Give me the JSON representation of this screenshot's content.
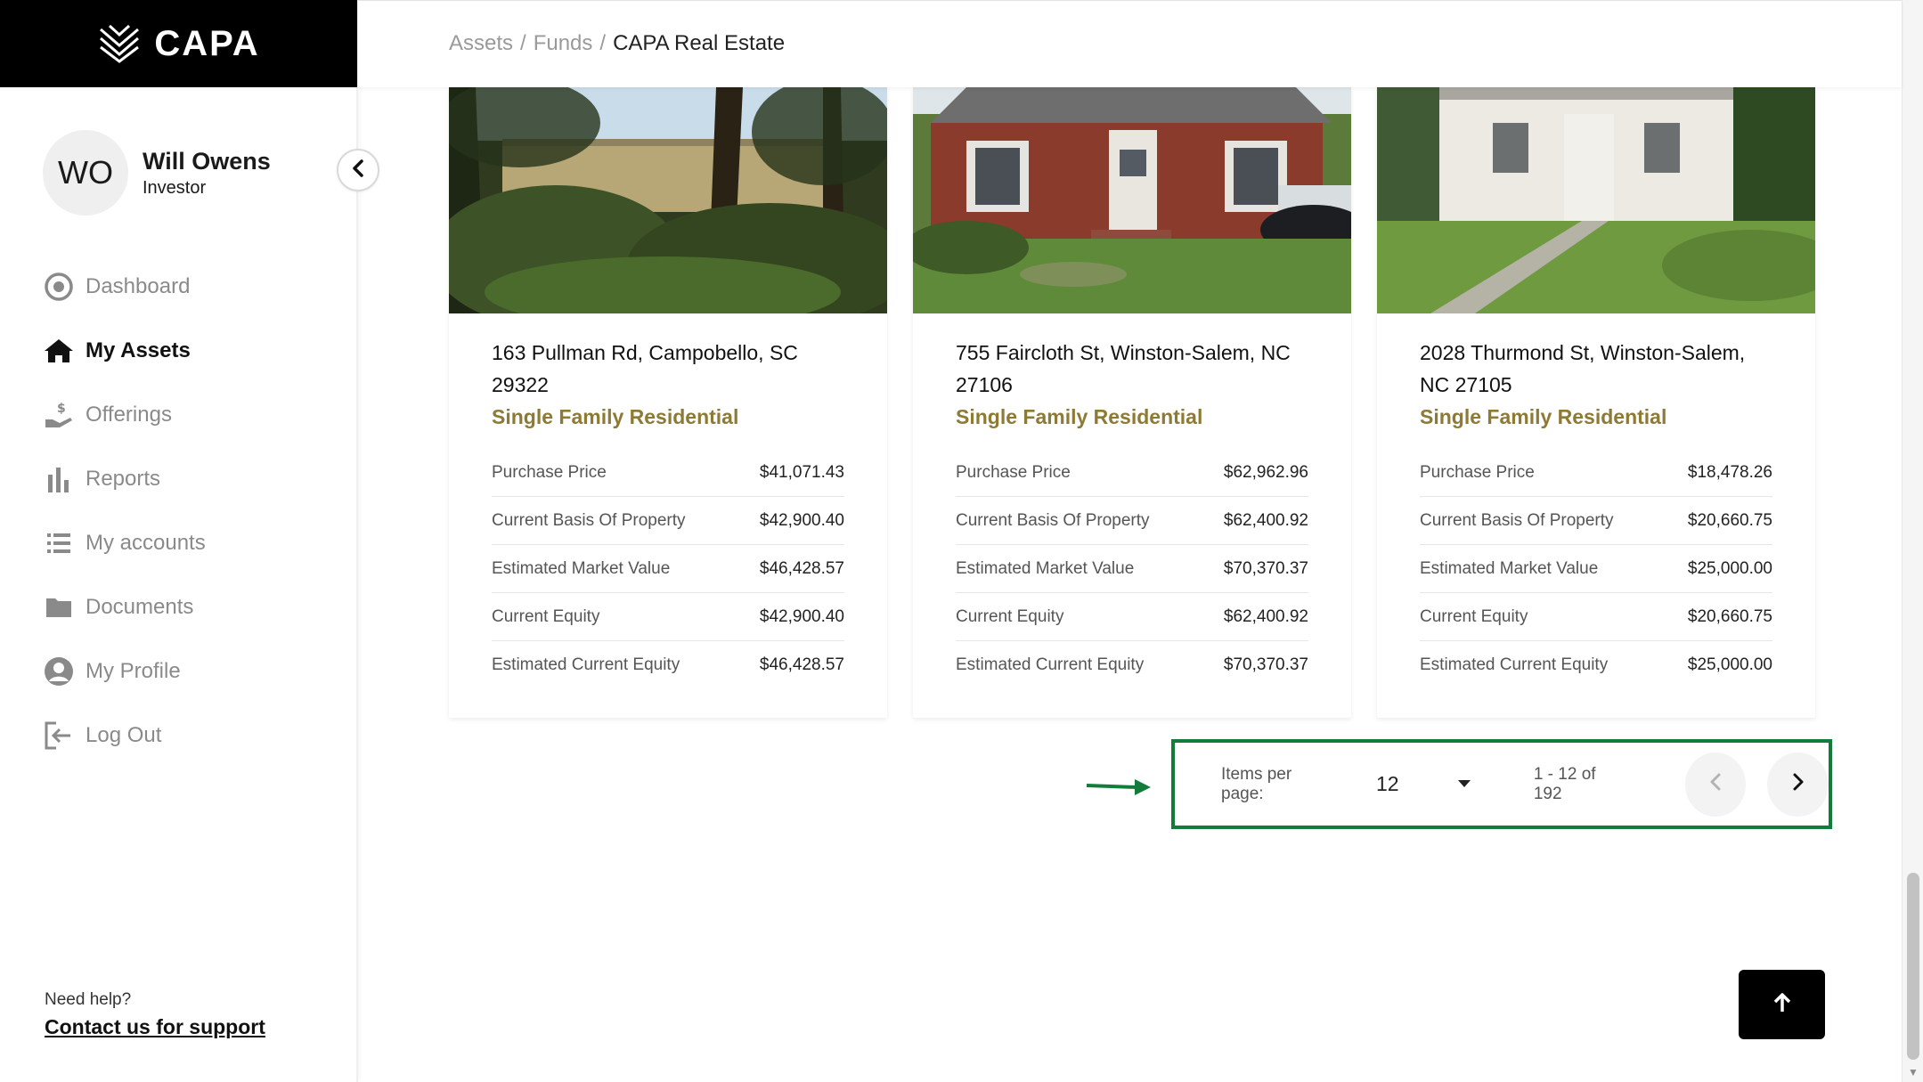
{
  "brand": {
    "name": "CAPA"
  },
  "user": {
    "initials": "WO",
    "name": "Will Owens",
    "role": "Investor"
  },
  "nav": [
    {
      "label": "Dashboard",
      "icon": "dashboard-icon"
    },
    {
      "label": "My Assets",
      "icon": "home-icon",
      "active": true
    },
    {
      "label": "Offerings",
      "icon": "hand-dollar-icon"
    },
    {
      "label": "Reports",
      "icon": "bar-chart-icon"
    },
    {
      "label": "My accounts",
      "icon": "list-icon"
    },
    {
      "label": "Documents",
      "icon": "folder-icon"
    },
    {
      "label": "My Profile",
      "icon": "user-circle-icon"
    },
    {
      "label": "Log Out",
      "icon": "logout-icon"
    }
  ],
  "help": {
    "question": "Need help?",
    "link": "Contact us for support"
  },
  "breadcrumb": {
    "items": [
      "Assets",
      "Funds"
    ],
    "current": "CAPA Real Estate",
    "separator": "/"
  },
  "cards": [
    {
      "address": "163 Pullman Rd, Campobello, SC 29322",
      "type": "Single Family Residential",
      "rows": [
        {
          "label": "Purchase Price",
          "value": "$41,071.43"
        },
        {
          "label": "Current Basis Of Property",
          "value": "$42,900.40"
        },
        {
          "label": "Estimated Market Value",
          "value": "$46,428.57"
        },
        {
          "label": "Current Equity",
          "value": "$42,900.40"
        },
        {
          "label": "Estimated Current Equity",
          "value": "$46,428.57"
        }
      ]
    },
    {
      "address": "755 Faircloth St, Winston-Salem, NC 27106",
      "type": "Single Family Residential",
      "rows": [
        {
          "label": "Purchase Price",
          "value": "$62,962.96"
        },
        {
          "label": "Current Basis Of Property",
          "value": "$62,400.92"
        },
        {
          "label": "Estimated Market Value",
          "value": "$70,370.37"
        },
        {
          "label": "Current Equity",
          "value": "$62,400.92"
        },
        {
          "label": "Estimated Current Equity",
          "value": "$70,370.37"
        }
      ]
    },
    {
      "address": "2028 Thurmond St, Winston-Salem, NC 27105",
      "type": "Single Family Residential",
      "rows": [
        {
          "label": "Purchase Price",
          "value": "$18,478.26"
        },
        {
          "label": "Current Basis Of Property",
          "value": "$20,660.75"
        },
        {
          "label": "Estimated Market Value",
          "value": "$25,000.00"
        },
        {
          "label": "Current Equity",
          "value": "$20,660.75"
        },
        {
          "label": "Estimated Current Equity",
          "value": "$25,000.00"
        }
      ]
    }
  ],
  "pagination": {
    "items_label": "Items per page:",
    "page_size": "12",
    "range": "1 - 12 of 192"
  },
  "colors": {
    "accent_gold": "#8d7a35",
    "highlight_green": "#127d3a",
    "brand_black": "#000000"
  }
}
